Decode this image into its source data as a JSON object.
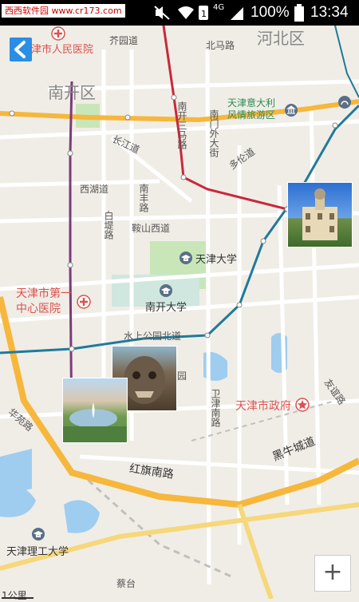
{
  "status_bar": {
    "watermark": "西西软件园 www.cr173.com",
    "battery_text": "100%",
    "time": "13:34",
    "network_label": "4G",
    "icons": [
      "mute-vibrate-icon",
      "wifi-icon",
      "sim-icon",
      "signal-icon",
      "battery-icon"
    ]
  },
  "map": {
    "district_labels": [
      "河北区",
      "南开区"
    ],
    "road_labels": [
      "芥园道",
      "北马路",
      "南开三马路",
      "南门外大街",
      "长江道",
      "多伦道",
      "西湖道",
      "南丰路",
      "白堤路",
      "鞍山西道",
      "水上公园北道",
      "卫津南路",
      "友谊路",
      "华苑路",
      "红旗南路",
      "黑牛城道",
      "蔡台",
      "园"
    ],
    "poi_labels": [
      "天津市人民医院",
      "天津意大利风情旅游区",
      "天津大学",
      "南开大学",
      "天津市第一中心医院",
      "天津市政府",
      "天津理工大学"
    ],
    "scale_text": "1公里",
    "colors": {
      "background": "#f0ede6",
      "major_road": "#f6b73c",
      "metro_red": "#c8283c",
      "metro_blue": "#1f7a9c",
      "metro_purple": "#7d3a7d",
      "park": "#c8e6b8",
      "water": "#9ecdf0",
      "poi_red": "#d9534f"
    }
  },
  "controls": {
    "zoom_in_symbol": "+",
    "back_icon": "chevron-left-icon"
  }
}
